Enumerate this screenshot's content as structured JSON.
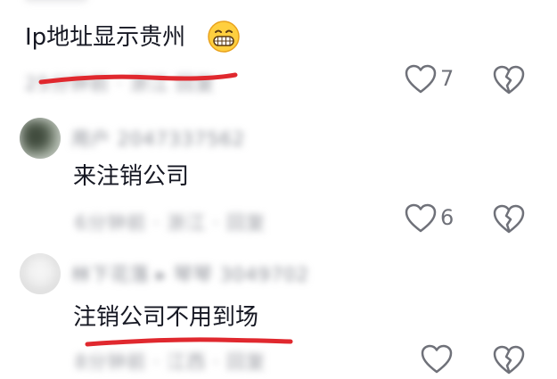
{
  "comments": [
    {
      "text": "Ip地址显示贵州",
      "emoji": "grinning-face-emoji",
      "meta": "25分钟前 · 浙江  回复",
      "like_count": "7",
      "annotation_color": "#e0282e"
    },
    {
      "username": "用户 2047337562",
      "text": "来注销公司",
      "meta": "6分钟前 · 浙江 · 回复",
      "like_count": "6"
    },
    {
      "username": "林下花落 ▸ 琴琴 3049702",
      "text": "注销公司不用到场",
      "meta": "8分钟前 · 江西 · 回复",
      "like_count": "",
      "annotation_color": "#e0282e"
    }
  ],
  "icons": {
    "like": "heart-outline-icon",
    "dislike": "broken-heart-icon"
  }
}
